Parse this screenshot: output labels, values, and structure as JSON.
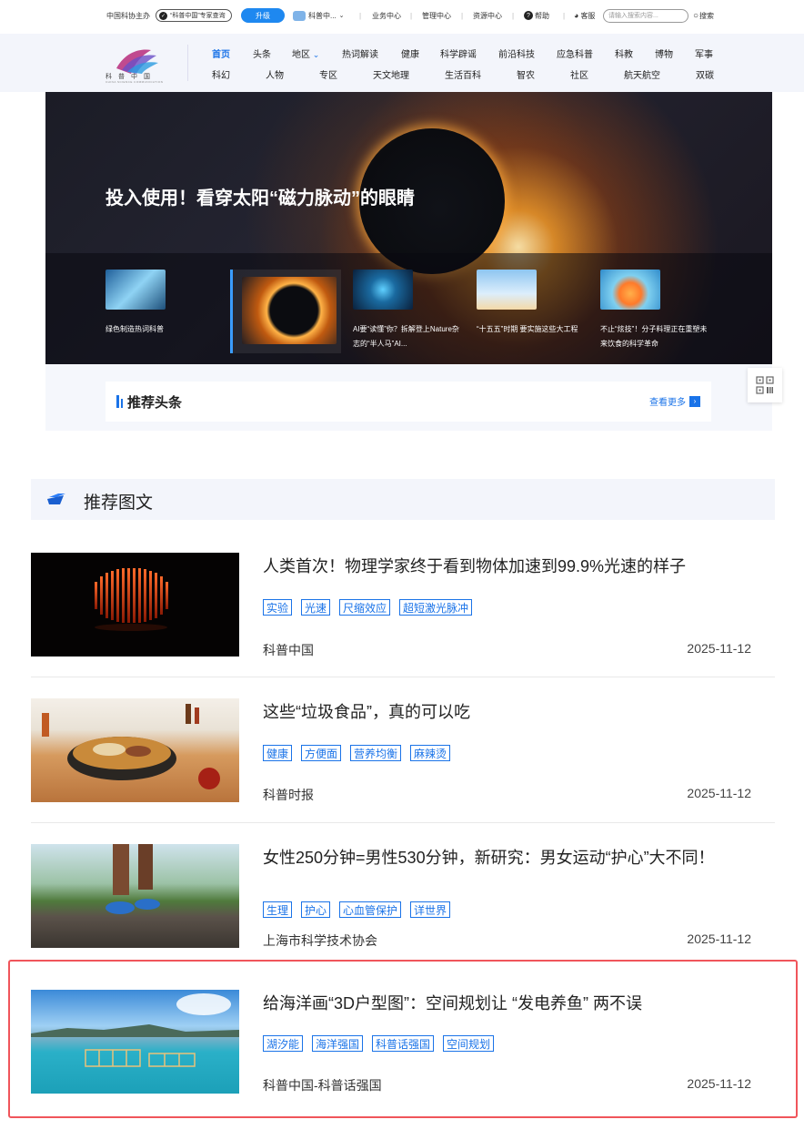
{
  "topbar": {
    "host": "中国科协主办",
    "expert_check": "“科普中国”专家查询",
    "upgrade": "升级",
    "user": "科普中...",
    "biz": "业务中心",
    "mgmt": "管理中心",
    "res": "资源中心",
    "help": "帮助",
    "service": "客服",
    "search_placeholder": "请输入搜索内容...",
    "search": "搜索"
  },
  "logo": {
    "text": "科普中国",
    "sub": "CHINA SCIENCE COMMUNICATION"
  },
  "nav": {
    "row1": [
      "首页",
      "头条",
      "地区",
      "热词解读",
      "健康",
      "科学辟谣",
      "前沿科技",
      "应急科普",
      "科教",
      "博物",
      "军事"
    ],
    "row2": [
      "科幻",
      "人物",
      "专区",
      "天文地理",
      "生活百科",
      "智农",
      "社区",
      "航天航空",
      "双碳"
    ]
  },
  "hero": {
    "title": "投入使用！看穿太阳“磁力脉动”的眼睛",
    "cards": [
      "绿色制造热词科普",
      "",
      "AI要“读懂”你？拆解登上Nature杂志的“半人马”AI...",
      "“十五五”时期 要实施这些大工程",
      "不止“炫技”！分子料理正在重塑未来饮食的科学革命"
    ]
  },
  "recommend_headlines": {
    "title": "推荐头条",
    "more": "查看更多"
  },
  "section": {
    "title": "推荐图文"
  },
  "articles": [
    {
      "title": "人类首次！物理学家终于看到物体加速到99.9%光速的样子",
      "tags": [
        "实验",
        "光速",
        "尺缩效应",
        "超短激光脉冲"
      ],
      "source": "科普中国",
      "date": "2025-11-12"
    },
    {
      "title": "这些“垃圾食品”，真的可以吃",
      "tags": [
        "健康",
        "方便面",
        "营养均衡",
        "麻辣烫"
      ],
      "source": "科普时报",
      "date": "2025-11-12"
    },
    {
      "title": "女性250分钟=男性530分钟，新研究：男女运动“护心”大不同！",
      "tags": [
        "生理",
        "护心",
        "心血管保护",
        "详世界"
      ],
      "source": "上海市科学技术协会",
      "date": "2025-11-12"
    },
    {
      "title": "给海洋画“3D户型图”：空间规划让 “发电养鱼” 两不误",
      "tags": [
        "湖汐能",
        "海洋强国",
        "科普话强国",
        "空间规划"
      ],
      "source": "科普中国-科普话强国",
      "date": "2025-11-12"
    }
  ],
  "colors": {
    "accent": "#1a73e8",
    "highlight": "#f0555b"
  }
}
